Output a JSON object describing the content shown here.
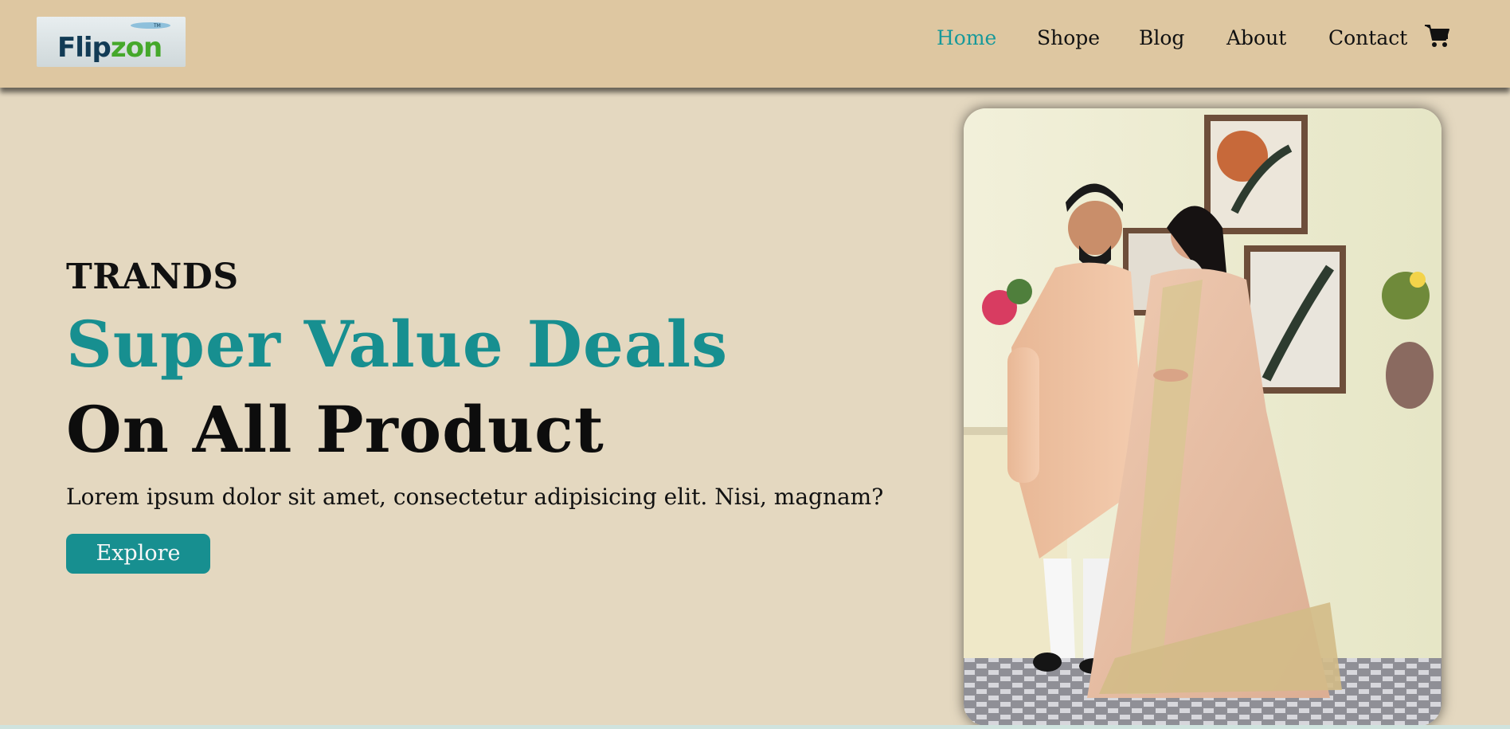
{
  "brand": {
    "logo_part1": "Flip",
    "logo_part2": "zon",
    "logo_tm": "TM"
  },
  "nav": {
    "items": [
      {
        "label": "Home",
        "active": true
      },
      {
        "label": "Shope",
        "active": false
      },
      {
        "label": "Blog",
        "active": false
      },
      {
        "label": "About",
        "active": false
      },
      {
        "label": "Contact",
        "active": false
      }
    ],
    "cart_icon": "cart-icon"
  },
  "hero": {
    "eyebrow": "TRANDS",
    "headline_accent": "Super Value Deals",
    "headline": "On All Product",
    "lead": "Lorem ipsum dolor sit amet, consectetur adipisicing elit. Nisi, magnam?",
    "cta_label": "Explore",
    "image_subject": "couple-in-ethnic-wear-photo"
  },
  "colors": {
    "header_bg": "#dec7a1",
    "page_bg": "#e4d8c0",
    "accent": "#178f90",
    "text": "#111111"
  }
}
